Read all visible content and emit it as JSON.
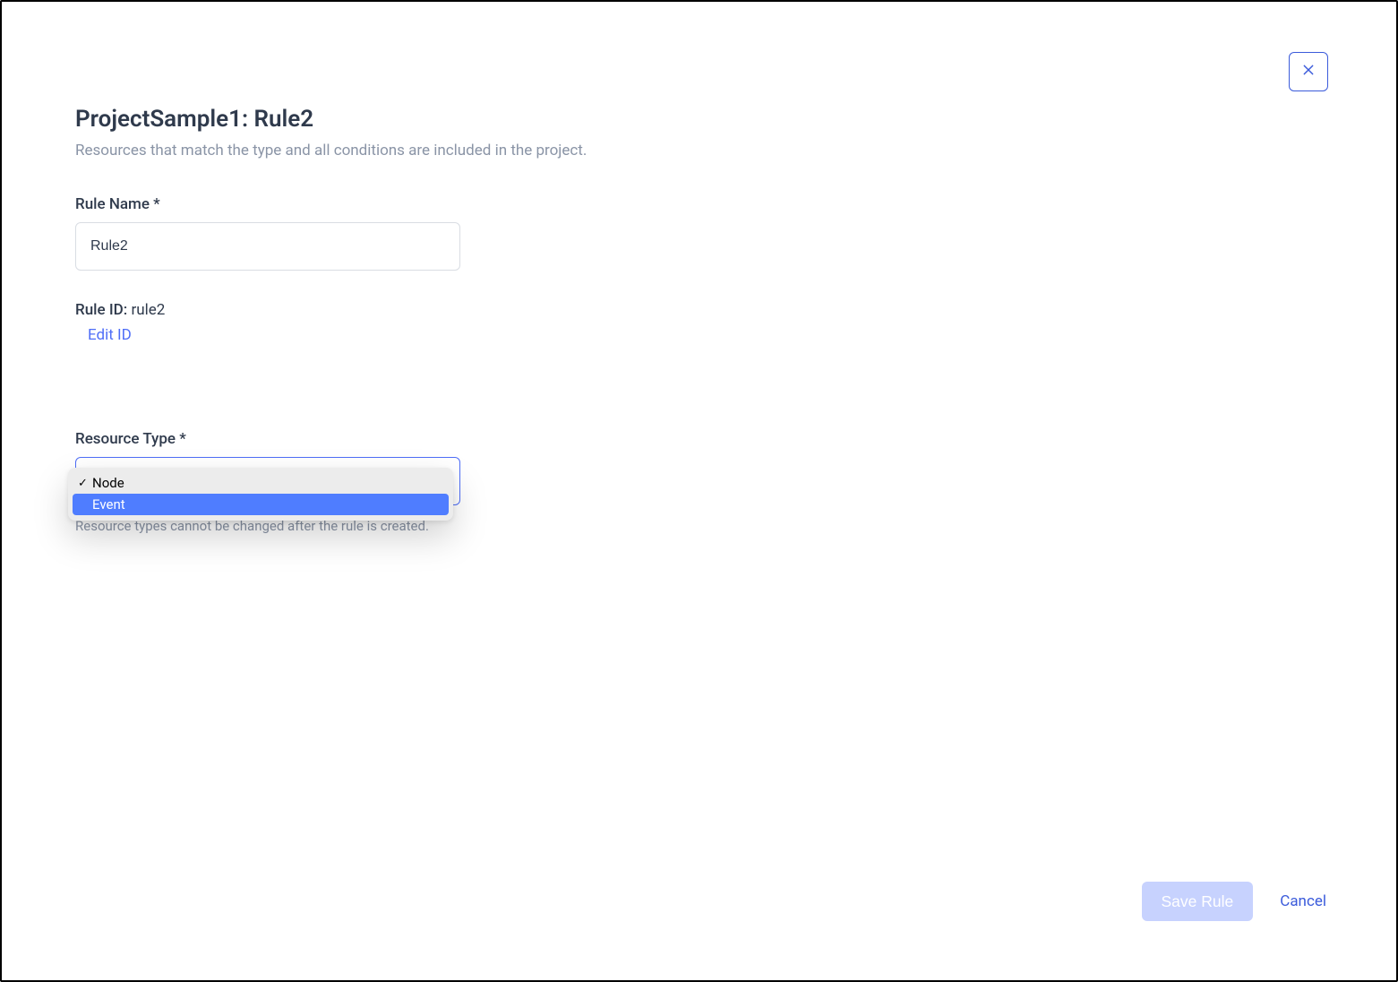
{
  "header": {
    "title": "ProjectSample1: Rule2",
    "subtitle": "Resources that match the type and all conditions are included in the project."
  },
  "form": {
    "rule_name": {
      "label": "Rule Name *",
      "value": "Rule2"
    },
    "rule_id": {
      "label": "Rule ID:",
      "value": "rule2",
      "edit_link": "Edit ID"
    },
    "resource_type": {
      "label": "Resource Type *",
      "helper": "Resource types cannot be changed after the rule is created.",
      "selected": "Node",
      "options": [
        {
          "label": "Node",
          "checked": true,
          "highlight": false
        },
        {
          "label": "Event",
          "checked": false,
          "highlight": true
        }
      ]
    }
  },
  "footer": {
    "save": "Save Rule",
    "cancel": "Cancel"
  }
}
